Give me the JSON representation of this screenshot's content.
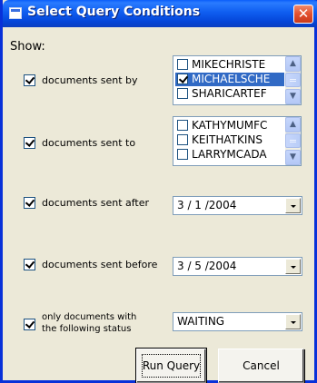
{
  "window": {
    "title": "Select Query Conditions",
    "close_glyph": "✕",
    "colors": {
      "titlebar": "#0a5dfa",
      "face": "#ece9d8",
      "selection": "#316ac5",
      "close": "#e2502e"
    }
  },
  "show_label": "Show:",
  "conditions": {
    "sent_by": {
      "label": "documents sent by",
      "checked": true,
      "items": [
        {
          "label": "MIKECHRISTE",
          "checked": false,
          "selected": false
        },
        {
          "label": "MICHAELSCHE",
          "checked": true,
          "selected": true
        },
        {
          "label": "SHARICARTEF",
          "checked": false,
          "selected": false
        }
      ]
    },
    "sent_to": {
      "label": "documents sent to",
      "checked": true,
      "items": [
        {
          "label": "KATHYMUMFC",
          "checked": false,
          "selected": false
        },
        {
          "label": "KEITHATKINS",
          "checked": false,
          "selected": false
        },
        {
          "label": "LARRYMCADA",
          "checked": false,
          "selected": false
        }
      ]
    },
    "sent_after": {
      "label": "documents sent after",
      "checked": true,
      "value": "3 / 1 /2004"
    },
    "sent_before": {
      "label": "documents sent before",
      "checked": true,
      "value": "3 / 5 /2004"
    },
    "status": {
      "label_line1": "only documents with",
      "label_line2": "the following status",
      "checked": true,
      "value": "WAITING"
    }
  },
  "buttons": {
    "run_query": "Run Query",
    "cancel": "Cancel"
  },
  "icons": {
    "window": "window-icon",
    "close": "close-icon",
    "scroll_up": "chevron-up-icon",
    "scroll_down": "chevron-down-icon",
    "dropdown": "chevron-down-icon"
  }
}
